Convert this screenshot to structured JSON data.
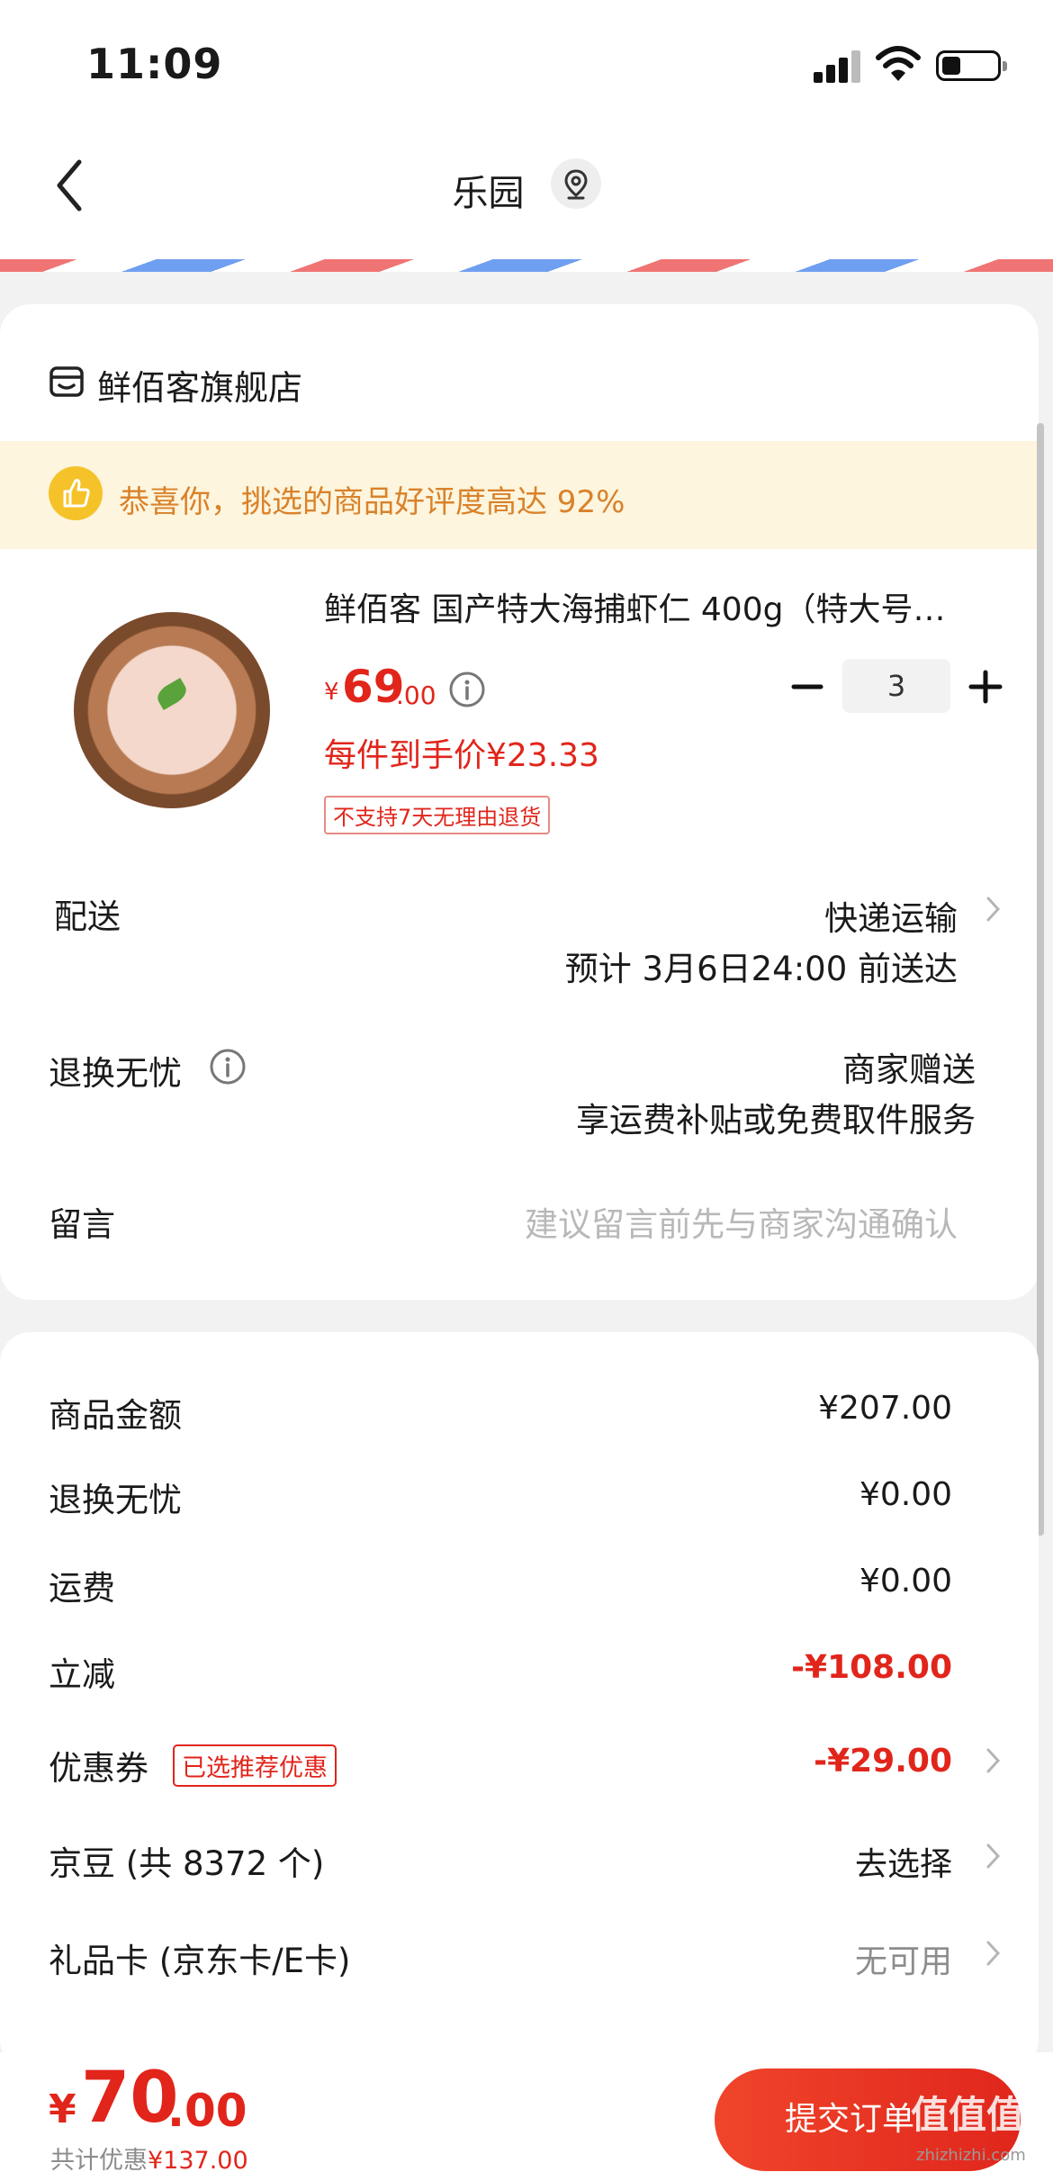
{
  "status_bar": {
    "time": "11:09"
  },
  "header": {
    "address_title": "乐园"
  },
  "store": {
    "name": "鲜佰客旗舰店"
  },
  "banner": {
    "text": "恭喜你，挑选的商品好评度高达 92%"
  },
  "product": {
    "title": "鲜佰客 国产特大海捕虾仁 400g（特大号…",
    "price_symbol": "¥",
    "price_int": "69",
    "price_dec": ".00",
    "quantity": "3",
    "unit_price": "每件到手价¥23.33",
    "return_tag": "不支持7天无理由退货"
  },
  "delivery": {
    "label": "配送",
    "method": "快递运输",
    "eta": "预计 3月6日24:00 前送达"
  },
  "return_service": {
    "label": "退换无忧",
    "value_line1": "商家赠送",
    "value_line2": "享运费补贴或免费取件服务"
  },
  "message": {
    "label": "留言",
    "placeholder": "建议留言前先与商家沟通确认"
  },
  "price_details": {
    "goods_amount": {
      "label": "商品金额",
      "value": "¥207.00"
    },
    "return_fee": {
      "label": "退换无忧",
      "value": "¥0.00"
    },
    "shipping": {
      "label": "运费",
      "value": "¥0.00"
    },
    "instant_discount": {
      "label": "立减",
      "value": "-¥108.00"
    },
    "coupon": {
      "label": "优惠券",
      "tag": "已选推荐优惠",
      "value": "-¥29.00"
    },
    "jd_beans": {
      "label": "京豆 (共 8372 个)",
      "value": "去选择"
    },
    "gift_card": {
      "label": "礼品卡 (京东卡/E卡)",
      "value": "无可用"
    }
  },
  "footer": {
    "total_symbol": "¥",
    "total_int": "70",
    "total_dec": ".00",
    "saved_label": "共计优惠",
    "saved_value": "¥137.00",
    "submit_label": "提交订单",
    "watermark": "值值值",
    "watermark_sub": "zhizhizhi.com"
  },
  "colors": {
    "accent_red": "#e1251b",
    "banner_bg": "#fdf5dd",
    "banner_text": "#d9822b",
    "page_bg": "#f2f2f2"
  },
  "icons": {
    "back": "chevron-left-icon",
    "location": "location-pin-icon",
    "store": "store-icon",
    "thumb": "thumbs-up-icon",
    "info": "info-icon",
    "minus": "minus-icon",
    "plus": "plus-icon",
    "chevron": "chevron-right-icon"
  }
}
